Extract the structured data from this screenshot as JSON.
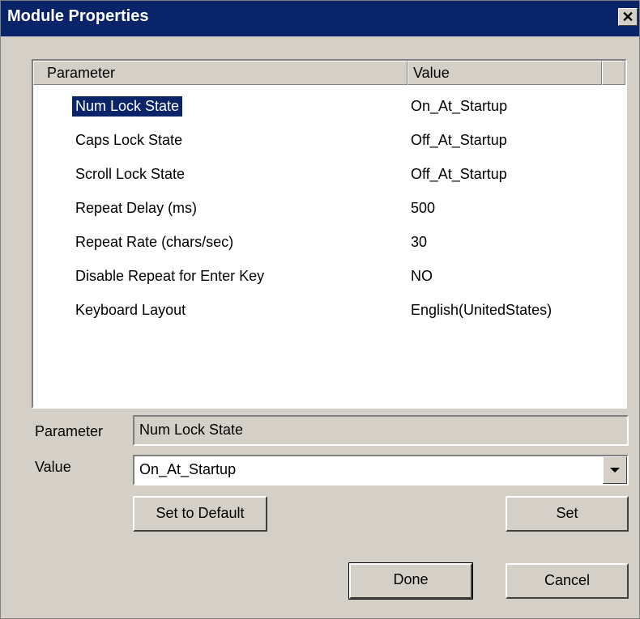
{
  "window": {
    "title": "Module Properties",
    "close_label": "✕"
  },
  "list": {
    "columns": {
      "parameter": "Parameter",
      "value": "Value"
    },
    "rows": [
      {
        "parameter": "Num Lock State",
        "value": "On_At_Startup"
      },
      {
        "parameter": "Caps Lock State",
        "value": "Off_At_Startup"
      },
      {
        "parameter": "Scroll Lock State",
        "value": "Off_At_Startup"
      },
      {
        "parameter": "Repeat Delay (ms)",
        "value": "500"
      },
      {
        "parameter": "Repeat Rate (chars/sec)",
        "value": "30"
      },
      {
        "parameter": "Disable Repeat for Enter Key",
        "value": "NO"
      },
      {
        "parameter": "Keyboard Layout",
        "value": "English(UnitedStates)"
      }
    ],
    "selected_index": 0
  },
  "editor": {
    "parameter_label": "Parameter",
    "parameter_value": "Num Lock State",
    "value_label": "Value",
    "value_selected": "On_At_Startup"
  },
  "buttons": {
    "set_default": "Set to Default",
    "set": "Set",
    "done": "Done",
    "cancel": "Cancel"
  },
  "colors": {
    "title_bar": "#0a246a",
    "dialog_bg": "#d4d0c8",
    "selection": "#0a246a"
  }
}
